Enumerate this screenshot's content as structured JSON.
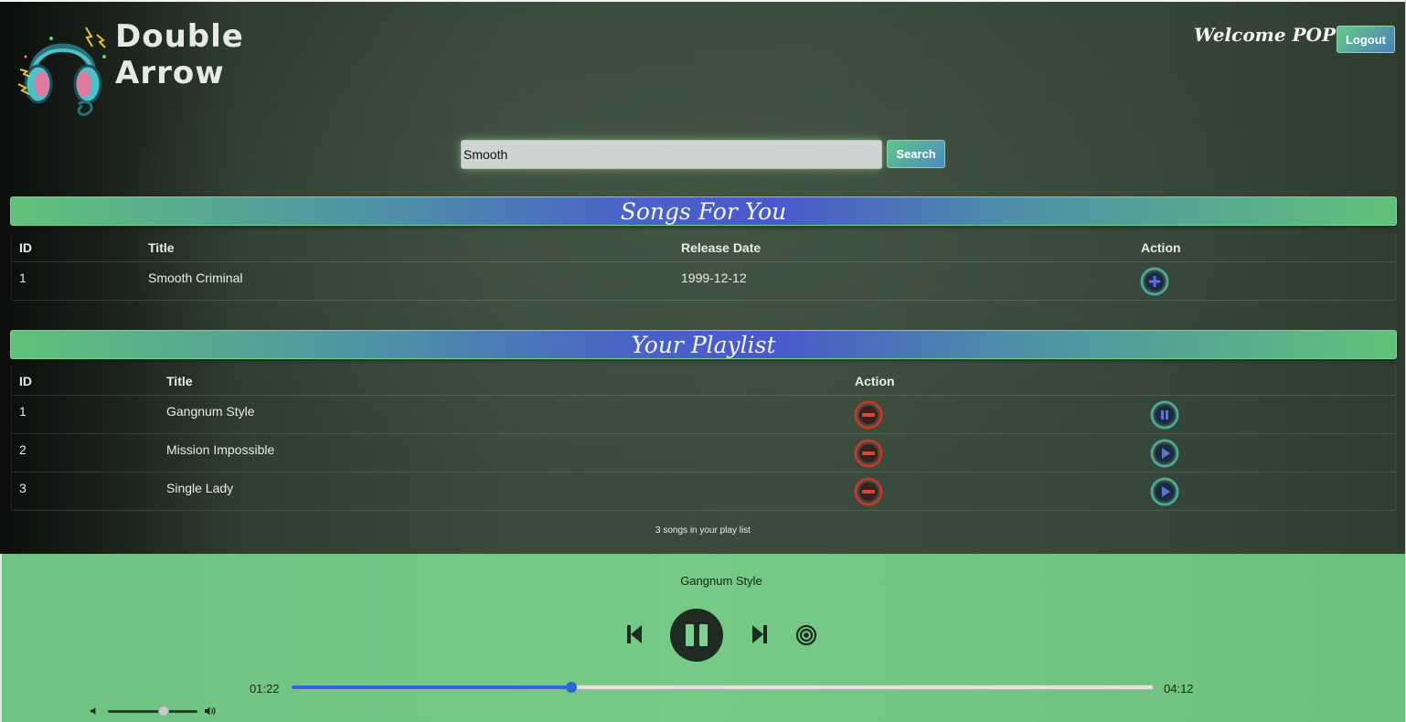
{
  "header": {
    "brand_line1": "Double",
    "brand_line2": "Arrow",
    "welcome": "Welcome POP",
    "logout_label": "Logout"
  },
  "search": {
    "value": "Smooth",
    "button_label": "Search"
  },
  "songs_for_you": {
    "title": "Songs For You",
    "columns": [
      "ID",
      "Title",
      "Release Date",
      "Action"
    ],
    "rows": [
      {
        "id": "1",
        "title": "Smooth Criminal",
        "release_date": "1999-12-12"
      }
    ]
  },
  "playlist": {
    "title": "Your Playlist",
    "columns": [
      "ID",
      "Title",
      "Action"
    ],
    "rows": [
      {
        "id": "1",
        "title": "Gangnum Style",
        "state": "playing"
      },
      {
        "id": "2",
        "title": "Mission Impossible",
        "state": "paused"
      },
      {
        "id": "3",
        "title": "Single Lady",
        "state": "paused"
      }
    ],
    "count_note": "3 songs in your play list"
  },
  "player": {
    "now_playing": "Gangnum Style",
    "current_time": "01:22",
    "total_time": "04:12",
    "progress_fraction": 0.325,
    "volume_fraction": 0.62
  },
  "colors": {
    "accent_green": "#6fc383",
    "accent_blue": "#2a68d8",
    "remove_red": "#c0392b",
    "play_teal": "#4aa59a"
  },
  "icons": [
    "headphones-logo",
    "add-icon",
    "remove-icon",
    "pause-icon",
    "play-icon",
    "previous-icon",
    "next-icon",
    "radio-icon",
    "volume-low-icon",
    "volume-high-icon"
  ]
}
